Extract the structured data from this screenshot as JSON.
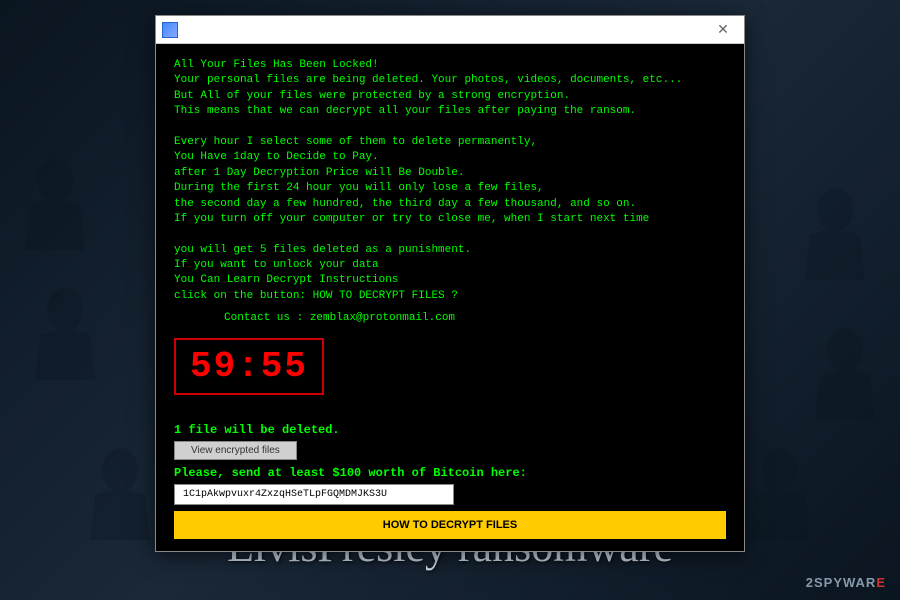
{
  "ransom": {
    "body": "All Your Files Has Been Locked!\nYour personal files are being deleted. Your photos, videos, documents, etc...\nBut All of your files were protected by a strong encryption.\nThis means that we can decrypt all your files after paying the ransom.\n\nEvery hour I select some of them to delete permanently,\nYou Have 1day to Decide to Pay.\nafter 1 Day Decryption Price will Be Double.\nDuring the first 24 hour you will only lose a few files,\nthe second day a few hundred, the third day a few thousand, and so on.\nIf you turn off your computer or try to close me, when I start next time\n\nyou will get 5 files deleted as a punishment.\nIf you want to unlock your data\nYou Can Learn Decrypt Instructions\nclick on the button: HOW TO DECRYPT FILES ?",
    "contact": "Contact us : zemblax@protonmail.com",
    "timer": "59:55",
    "deleted": "1 file will be deleted.",
    "view_button": "View encrypted files",
    "send_text": "Please, send at least $100 worth of Bitcoin here:",
    "bitcoin_address": "1C1pAkwpvuxr4ZxzqHSeTLpFGQMDMJKS3U",
    "decrypt_button": "HOW TO DECRYPT FILES"
  },
  "page": {
    "title": "ElvisPresley ransomware",
    "watermark_1": "2SPYWAR",
    "watermark_2": "E"
  },
  "colors": {
    "terminal_green": "#00ff00",
    "timer_red": "#ff0000",
    "button_yellow": "#ffcc00"
  }
}
